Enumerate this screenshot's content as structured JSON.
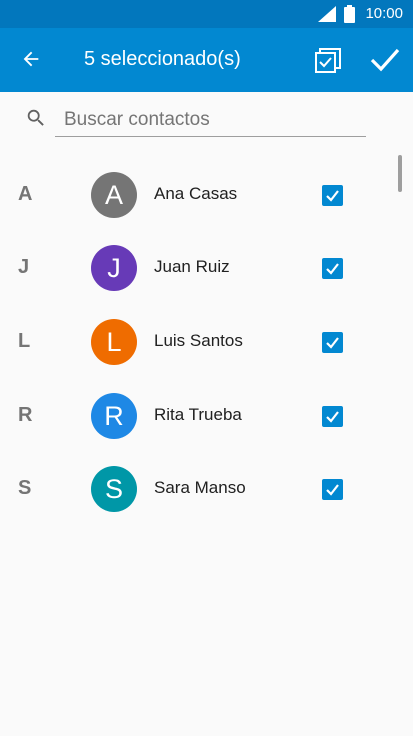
{
  "status": {
    "time": "10:00",
    "signal_icon": "signal-icon",
    "battery_icon": "battery-icon"
  },
  "appbar": {
    "title": "5 seleccionado(s)",
    "back_icon": "back-arrow-icon",
    "select_all_icon": "select-all-icon",
    "done_icon": "checkmark-icon",
    "color": "#0288d1"
  },
  "search": {
    "placeholder": "Buscar contactos",
    "value": ""
  },
  "contacts": [
    {
      "section": "A",
      "initial": "A",
      "name": "Ana Casas",
      "avatar_color": "#757575",
      "checked": true
    },
    {
      "section": "J",
      "initial": "J",
      "name": "Juan Ruiz",
      "avatar_color": "#673ab7",
      "checked": true
    },
    {
      "section": "L",
      "initial": "L",
      "name": "Luis Santos",
      "avatar_color": "#ef6c00",
      "checked": true
    },
    {
      "section": "R",
      "initial": "R",
      "name": "Rita Trueba",
      "avatar_color": "#1e88e5",
      "checked": true
    },
    {
      "section": "S",
      "initial": "S",
      "name": "Sara Manso",
      "avatar_color": "#0097a7",
      "checked": true
    }
  ]
}
